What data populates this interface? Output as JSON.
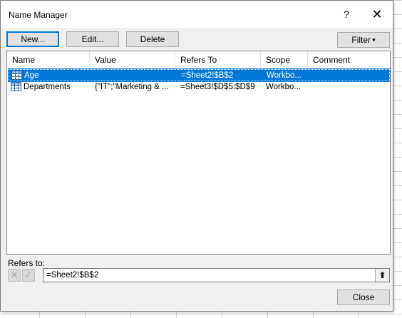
{
  "dialog": {
    "title": "Name Manager",
    "help_glyph": "?",
    "close_glyph": "✕"
  },
  "toolbar": {
    "new_label": "New...",
    "edit_label": "Edit...",
    "delete_label": "Delete",
    "filter_label": "Filter",
    "filter_arrow": "▾"
  },
  "table": {
    "columns": [
      "Name",
      "Value",
      "Refers To",
      "Scope",
      "Comment"
    ],
    "rows": [
      {
        "name": "Age",
        "value": "",
        "refers_to": "=Sheet2!$B$2",
        "scope": "Workbo...",
        "comment": "",
        "selected": true,
        "icon": "name-range-icon"
      },
      {
        "name": "Departments",
        "value": "{\"IT\";\"Marketing & ...",
        "refers_to": "=Sheet3!$D$5:$D$9",
        "scope": "Workbo...",
        "comment": "",
        "selected": false,
        "icon": "name-range-icon"
      }
    ]
  },
  "refers_to": {
    "label": "Refers to:",
    "value": "=Sheet2!$B$2",
    "cancel_icon": "cancel-x-icon",
    "enter_icon": "checkmark-icon",
    "collapse_icon": "collapse-dialog-icon"
  },
  "footer": {
    "close_label": "Close"
  },
  "colors": {
    "selection": "#0078d7",
    "dialog_bg": "#f0f0f0",
    "button_bg": "#e1e1e1"
  }
}
